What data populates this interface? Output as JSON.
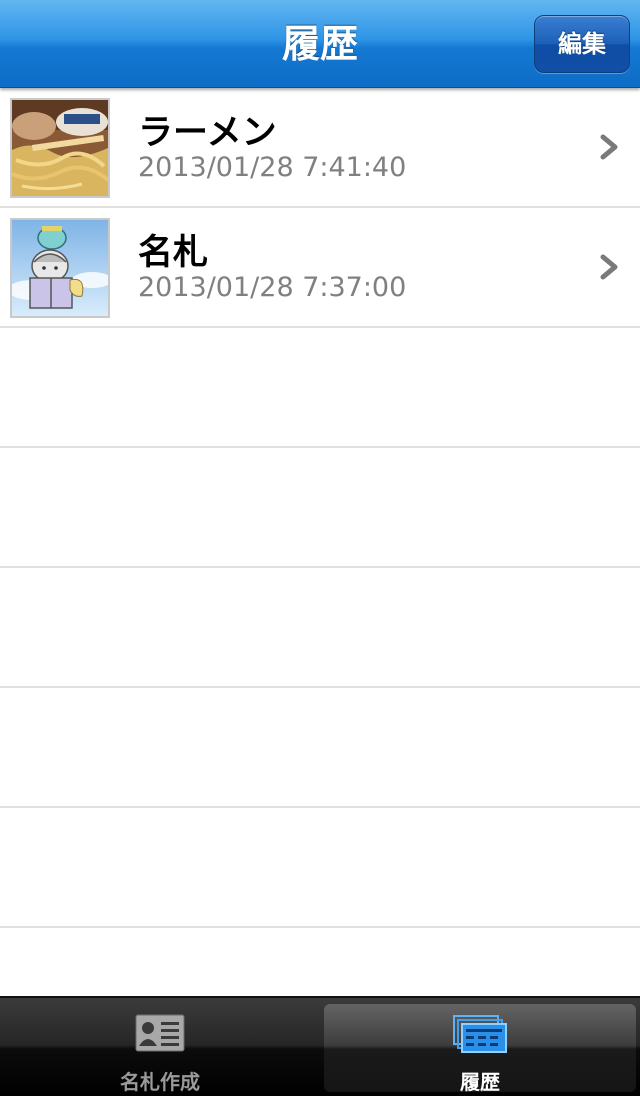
{
  "navbar": {
    "title": "履歴",
    "edit_label": "編集"
  },
  "history": {
    "items": [
      {
        "title": "ラーメン",
        "timestamp": "2013/01/28 7:41:40",
        "thumbnail": "ramen-photo"
      },
      {
        "title": "名札",
        "timestamp": "2013/01/28 7:37:00",
        "thumbnail": "name-tag-illustration"
      }
    ]
  },
  "tabbar": {
    "tabs": [
      {
        "label": "名札作成",
        "icon": "id-card-icon",
        "selected": false
      },
      {
        "label": "履歴",
        "icon": "history-stack-icon",
        "selected": true
      }
    ]
  },
  "colors": {
    "nav_blue": "#1579d3",
    "separator": "#e0e0e0",
    "subtitle_gray": "#808080",
    "tab_active_icon": "#2a8fe8"
  }
}
